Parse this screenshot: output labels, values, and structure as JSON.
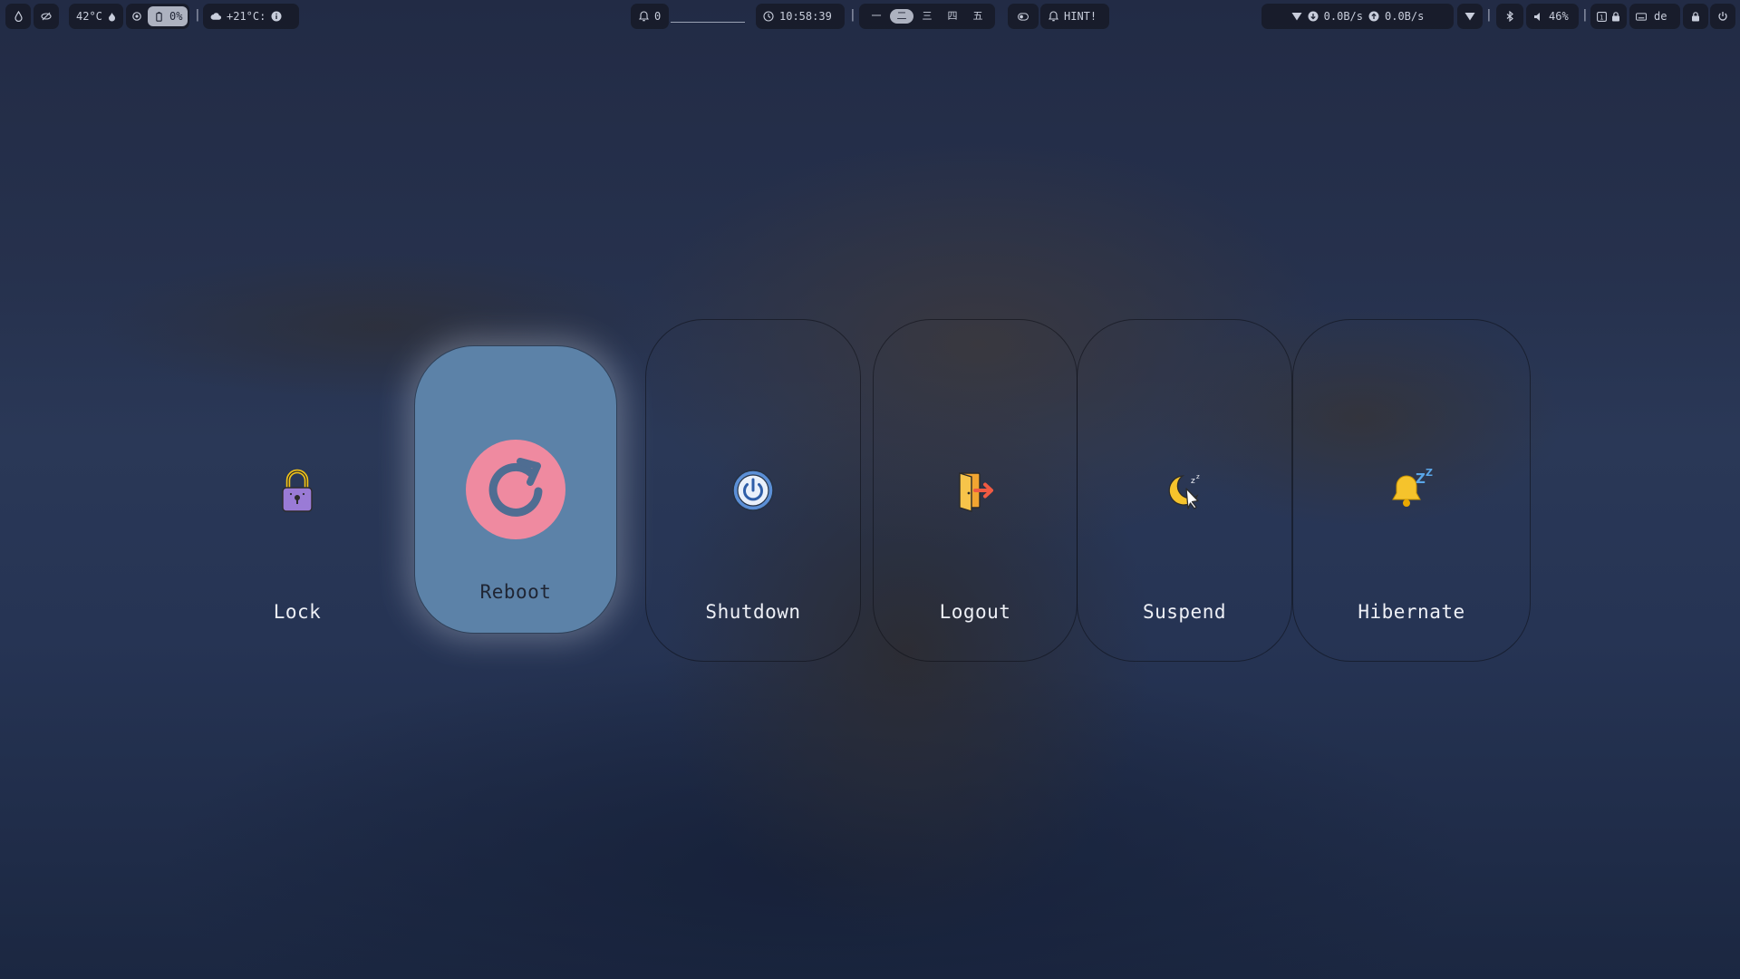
{
  "topbar": {
    "left": {
      "temperature": "42°C",
      "brightness": "0%",
      "weather": "+21°C:"
    },
    "center": {
      "notifications_count": "0",
      "clock": "10:58:39",
      "hint": "HINT!"
    },
    "right": {
      "net_down": "0.0B/s",
      "net_up": "0.0B/s",
      "volume": "46%",
      "keyboard_layout": "de"
    }
  },
  "power_menu": {
    "selected": "Reboot",
    "options": [
      {
        "label": "Lock",
        "icon": "lock-icon"
      },
      {
        "label": "Reboot",
        "icon": "reboot-icon"
      },
      {
        "label": "Shutdown",
        "icon": "power-icon"
      },
      {
        "label": "Logout",
        "icon": "logout-door-icon"
      },
      {
        "label": "Suspend",
        "icon": "moon-sleep-icon"
      },
      {
        "label": "Hibernate",
        "icon": "bell-zzz-icon"
      }
    ]
  },
  "colors": {
    "selected_bg": "#5c82a8",
    "reboot_icon": "#ef8aa0",
    "bar_bg": "#161a26"
  }
}
